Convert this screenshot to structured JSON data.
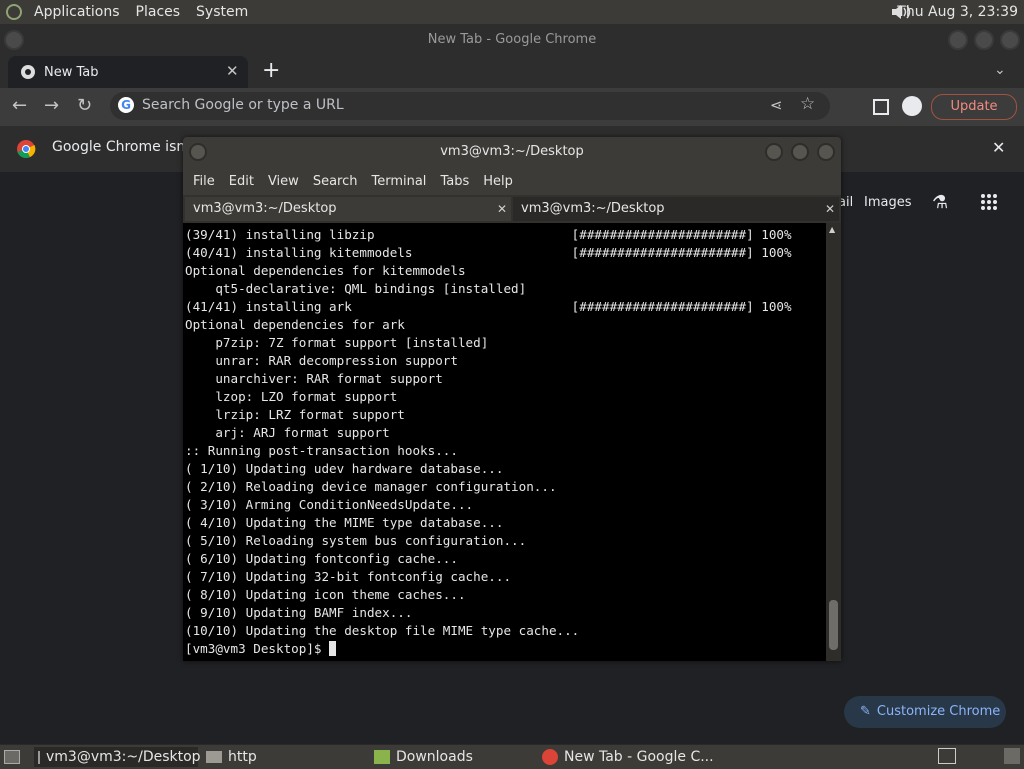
{
  "top_panel": {
    "menus": [
      "Applications",
      "Places",
      "System"
    ],
    "clock": "Thu Aug  3, 23:39",
    "volume_icon": "speaker-icon"
  },
  "chrome": {
    "window_title": "New Tab - Google Chrome",
    "tab_title": "New Tab",
    "omnibox_placeholder": "Search Google or type a URL",
    "update_label": "Update",
    "infobar_text": "Google Chrome isn't y",
    "ntp_links": [
      "ail",
      "Images"
    ],
    "customize_label": "Customize Chrome",
    "accent": "#8ab4f8"
  },
  "terminal": {
    "title": "vm3@vm3:~/Desktop",
    "menu": [
      "File",
      "Edit",
      "View",
      "Search",
      "Terminal",
      "Tabs",
      "Help"
    ],
    "tabs": [
      "vm3@vm3:~/Desktop",
      "vm3@vm3:~/Desktop"
    ],
    "lines": [
      "(39/41) installing libzip                          [######################] 100%",
      "(40/41) installing kitemmodels                     [######################] 100%",
      "Optional dependencies for kitemmodels",
      "    qt5-declarative: QML bindings [installed]",
      "(41/41) installing ark                             [######################] 100%",
      "Optional dependencies for ark",
      "    p7zip: 7Z format support [installed]",
      "    unrar: RAR decompression support",
      "    unarchiver: RAR format support",
      "    lzop: LZO format support",
      "    lrzip: LRZ format support",
      "    arj: ARJ format support",
      ":: Running post-transaction hooks...",
      "( 1/10) Updating udev hardware database...",
      "( 2/10) Reloading device manager configuration...",
      "( 3/10) Arming ConditionNeedsUpdate...",
      "( 4/10) Updating the MIME type database...",
      "( 5/10) Reloading system bus configuration...",
      "( 6/10) Updating fontconfig cache...",
      "( 7/10) Updating 32-bit fontconfig cache...",
      "( 8/10) Updating icon theme caches...",
      "( 9/10) Updating BAMF index...",
      "(10/10) Updating the desktop file MIME type cache..."
    ],
    "prompt": "[vm3@vm3 Desktop]$ "
  },
  "taskbar": {
    "items": [
      "vm3@vm3:~/Desktop",
      "http",
      "Downloads",
      "New Tab - Google C..."
    ]
  }
}
